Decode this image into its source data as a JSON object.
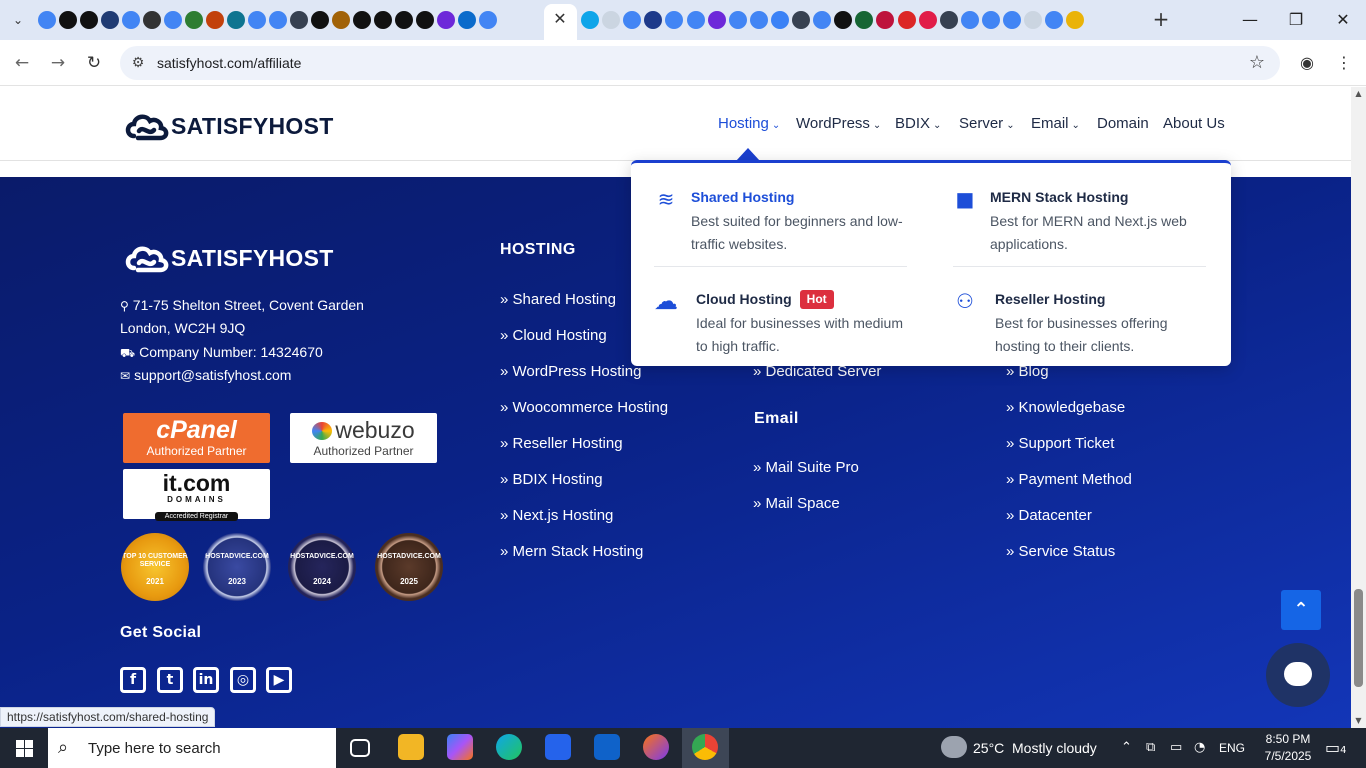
{
  "browser": {
    "tab_dropdown": "⌄",
    "active_tab_close": "✕",
    "new_tab": "+",
    "window": {
      "minimize": "—",
      "restore": "❐",
      "close": "✕"
    },
    "back": "←",
    "forward": "→",
    "reload": "↻",
    "site_info_icon": "⚙",
    "url": "satisfyhost.com/affiliate",
    "bookmark_icon": "☆",
    "profile_icon": "◉",
    "menu_icon": "⋮",
    "status_url": "https://satisfyhost.com/shared-hosting"
  },
  "header": {
    "logo_text": "SATISFYHOST",
    "nav": [
      {
        "label": "Hosting",
        "caret": "⌄",
        "active": true
      },
      {
        "label": "WordPress",
        "caret": "⌄"
      },
      {
        "label": "BDIX",
        "caret": "⌄"
      },
      {
        "label": "Server",
        "caret": "⌄"
      },
      {
        "label": "Email",
        "caret": "⌄"
      },
      {
        "label": "Domain",
        "caret": ""
      },
      {
        "label": "About Us",
        "caret": ""
      }
    ]
  },
  "mega_menu": {
    "items": [
      {
        "title": "Shared Hosting",
        "desc_line1": "Best suited for beginners and low-",
        "desc_line2": "traffic websites.",
        "icon": "layers-icon",
        "glyph": "≋"
      },
      {
        "title": "MERN Stack Hosting",
        "desc_line1": "Best for MERN and Next.js web",
        "desc_line2": "applications.",
        "icon": "cube-icon",
        "glyph": "■"
      },
      {
        "title": "Cloud Hosting",
        "badge": "Hot",
        "desc_line1": "Ideal for businesses with medium",
        "desc_line2": "to high traffic.",
        "icon": "cloud-icon",
        "glyph": "☁"
      },
      {
        "title": "Reseller Hosting",
        "desc_line1": "Best for businesses offering",
        "desc_line2": "hosting to their clients.",
        "icon": "users-add-icon",
        "glyph": "⚇"
      }
    ]
  },
  "footer": {
    "logo_text": "SATISFYHOST",
    "address_line1": "71-75 Shelton Street, Covent Garden",
    "address_line2": "London, WC2H 9JQ",
    "company_number": "Company Number: 14324670",
    "email": "support@satisfyhost.com",
    "icons": {
      "pin": "⚲",
      "company": "⛟",
      "mail": "✉"
    },
    "badges": {
      "cpanel": {
        "name": "cPanel",
        "sub": "Authorized Partner"
      },
      "webuzo": {
        "name": "webuzo",
        "sub": "Authorized Partner"
      },
      "itcom": {
        "name": "it.com",
        "sub": "DOMAINS",
        "tag": "Accredited Registrar"
      }
    },
    "seals": [
      {
        "top": "TOP 10 CUSTOMER SERVICE",
        "year": "2021"
      },
      {
        "top": "HOSTADVICE.COM",
        "year": "2023"
      },
      {
        "top": "HOSTADVICE.COM",
        "year": "2024"
      },
      {
        "top": "HOSTADVICE.COM",
        "year": "2025"
      }
    ],
    "get_social": "Get Social",
    "social": [
      {
        "name": "facebook-icon",
        "glyph": "f"
      },
      {
        "name": "twitter-icon",
        "glyph": "t"
      },
      {
        "name": "linkedin-icon",
        "glyph": "in"
      },
      {
        "name": "instagram-icon",
        "glyph": "◎"
      },
      {
        "name": "youtube-icon",
        "glyph": "▶"
      }
    ],
    "hosting_heading": "HOSTING",
    "hosting_links": [
      "» Shared Hosting",
      "» Cloud Hosting",
      "» WordPress Hosting",
      "» Woocommerce Hosting",
      "» Reseller Hosting",
      "» BDIX Hosting",
      "» Next.js Hosting",
      "» Mern Stack Hosting"
    ],
    "server_links": [
      "» Dedicated Server"
    ],
    "email_heading": "Email",
    "email_links": [
      "» Mail Suite Pro",
      "» Mail Space"
    ],
    "support_links": [
      "» Blog",
      "» Knowledgebase",
      "» Support Ticket",
      "» Payment Method",
      "» Datacenter",
      "» Service Status"
    ],
    "scroll_top_icon": "⌃"
  },
  "taskbar": {
    "search_placeholder": "Type here to search",
    "search_icon": "⌕",
    "weather_temp": "25°C",
    "weather_desc": "Mostly cloudy",
    "language": "ENG",
    "time": "8:50 PM",
    "date": "7/5/2025",
    "notification_count": "4",
    "tray_chevron": "⌃",
    "notification_icon": "▭"
  },
  "colors": {
    "brand_dark": "#0c1a3c",
    "accent_blue": "#1d4ed8",
    "footer_bg": "#0a2287",
    "hot_badge": "#dc2f3e"
  }
}
